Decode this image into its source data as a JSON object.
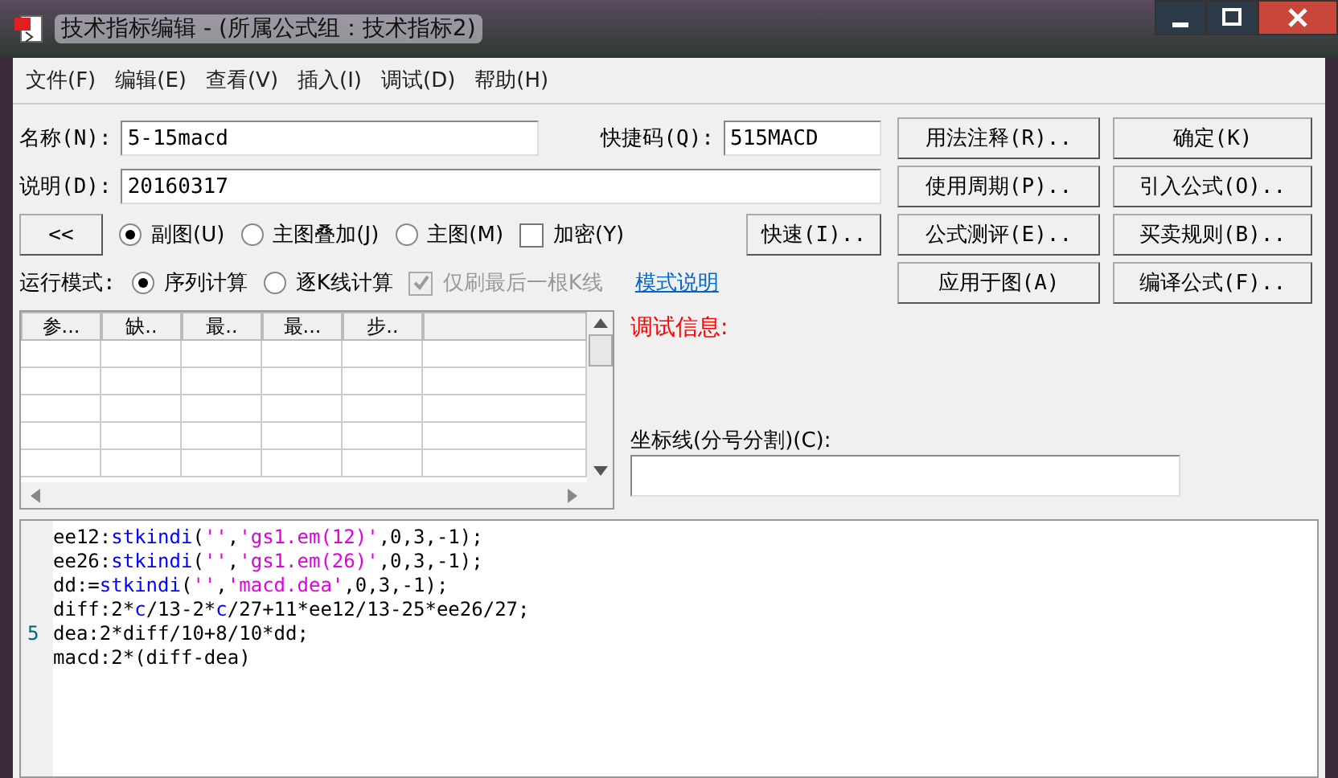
{
  "window": {
    "title": "技术指标编辑 - (所属公式组：技术指标2)"
  },
  "menu": [
    "文件(F)",
    "编辑(E)",
    "查看(V)",
    "插入(I)",
    "调试(D)",
    "帮助(H)"
  ],
  "name_field": {
    "label": "名称(N):",
    "value": "5-15macd"
  },
  "shortcut_field": {
    "label": "快捷码(Q):",
    "value": "515MACD"
  },
  "description_field": {
    "label": "说明(D):",
    "value": "20160317"
  },
  "collapse_button": "<<",
  "chart_type": [
    {
      "label": "副图(U)",
      "selected": true
    },
    {
      "label": "主图叠加(J)",
      "selected": false
    },
    {
      "label": "主图(M)",
      "selected": false
    }
  ],
  "encrypt": {
    "label": "加密(Y)",
    "checked": false
  },
  "quick_button": "快速(I)..",
  "run_mode": {
    "label": "运行模式:",
    "options": [
      {
        "label": "序列计算",
        "selected": true
      },
      {
        "label": "逐K线计算",
        "selected": false
      }
    ],
    "refresh_last": {
      "label": "仅刷最后一根K线",
      "checked": true,
      "disabled": true
    },
    "help_link": "模式说明"
  },
  "buttons": [
    [
      "用法注释(R)..",
      "确定(K)"
    ],
    [
      "使用周期(P)..",
      "引入公式(O).."
    ],
    [
      "公式测评(E)..",
      "买卖规则(B).."
    ],
    [
      "应用于图(A)",
      "编译公式(F).."
    ]
  ],
  "param_table": {
    "columns": [
      "参...",
      "缺..",
      "最..",
      "最...",
      "步.."
    ]
  },
  "debug_label": "调试信息:",
  "axis_lines": {
    "label": "坐标线(分号分割)(C):"
  },
  "code": {
    "marker_line": "5",
    "lines": [
      [
        {
          "kind": "plain",
          "text": "ee12:"
        },
        {
          "kind": "func",
          "text": "stkindi"
        },
        {
          "kind": "plain",
          "text": "("
        },
        {
          "kind": "str",
          "text": "''"
        },
        {
          "kind": "plain",
          "text": ","
        },
        {
          "kind": "str",
          "text": "'gs1.em(12)'"
        },
        {
          "kind": "plain",
          "text": ",0,3,-1);"
        }
      ],
      [
        {
          "kind": "plain",
          "text": "ee26:"
        },
        {
          "kind": "func",
          "text": "stkindi"
        },
        {
          "kind": "plain",
          "text": "("
        },
        {
          "kind": "str",
          "text": "''"
        },
        {
          "kind": "plain",
          "text": ","
        },
        {
          "kind": "str",
          "text": "'gs1.em(26)'"
        },
        {
          "kind": "plain",
          "text": ",0,3,-1);"
        }
      ],
      [
        {
          "kind": "plain",
          "text": "dd:="
        },
        {
          "kind": "func",
          "text": "stkindi"
        },
        {
          "kind": "plain",
          "text": "("
        },
        {
          "kind": "str",
          "text": "''"
        },
        {
          "kind": "plain",
          "text": ","
        },
        {
          "kind": "str",
          "text": "'macd.dea'"
        },
        {
          "kind": "plain",
          "text": ",0,3,-1);"
        }
      ],
      [
        {
          "kind": "plain",
          "text": "diff:2*"
        },
        {
          "kind": "func",
          "text": "c"
        },
        {
          "kind": "plain",
          "text": "/13-2*"
        },
        {
          "kind": "func",
          "text": "c"
        },
        {
          "kind": "plain",
          "text": "/27+11*ee12/13-25*ee26/27;"
        }
      ],
      [
        {
          "kind": "plain",
          "text": "dea:2*diff/10+8/10*dd;"
        }
      ],
      [
        {
          "kind": "plain",
          "text": "macd:2*(diff-dea)"
        }
      ]
    ]
  }
}
